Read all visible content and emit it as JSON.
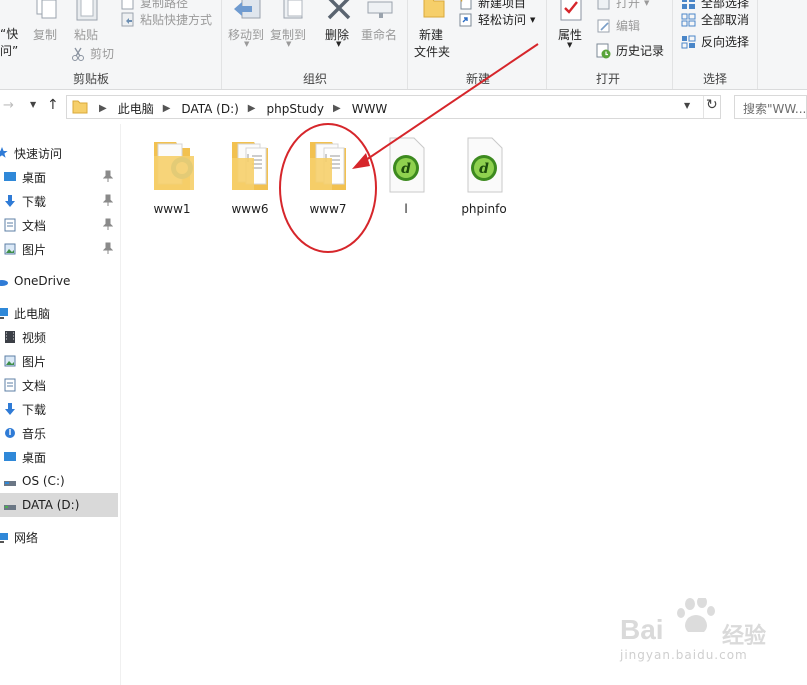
{
  "ribbon": {
    "clipboard": {
      "pin_label_line1": "“快",
      "pin_label_line2": "问”",
      "copy_label": "复制",
      "paste_label": "粘贴",
      "copy_path_label": "复制路径",
      "paste_shortcut_label": "粘贴快捷方式",
      "cut_label": "剪切",
      "group_label": "剪贴板"
    },
    "organize": {
      "move_to_label": "移动到",
      "copy_to_label": "复制到",
      "delete_label": "删除",
      "rename_label": "重命名",
      "group_label": "组织"
    },
    "new": {
      "new_folder_line1": "新建",
      "new_folder_line2": "文件夹",
      "new_item_label": "新建项目",
      "easy_access_label": "轻松访问",
      "group_label": "新建"
    },
    "open": {
      "properties_label": "属性",
      "open_label": "打开",
      "edit_label": "编辑",
      "history_label": "历史记录",
      "group_label": "打开"
    },
    "select": {
      "select_all_label": "全部选择",
      "select_none_label": "全部取消",
      "invert_label": "反向选择",
      "group_label": "选择"
    }
  },
  "address": {
    "crumbs": [
      "此电脑",
      "DATA (D:)",
      "phpStudy",
      "WWW"
    ],
    "search_placeholder": "搜索\"WW..."
  },
  "sidebar": {
    "items": [
      {
        "label": "快速访问",
        "icon": "star-icon"
      },
      {
        "label": "桌面",
        "icon": "desktop-icon"
      },
      {
        "label": "下载",
        "icon": "download-icon"
      },
      {
        "label": "文档",
        "icon": "document-icon"
      },
      {
        "label": "图片",
        "icon": "picture-icon"
      },
      {
        "label": "OneDrive",
        "icon": "cloud-icon"
      },
      {
        "label": "此电脑",
        "icon": "computer-icon"
      },
      {
        "label": "视频",
        "icon": "video-icon"
      },
      {
        "label": "图片",
        "icon": "picture-icon"
      },
      {
        "label": "文档",
        "icon": "document-icon"
      },
      {
        "label": "下载",
        "icon": "download-icon"
      },
      {
        "label": "音乐",
        "icon": "music-icon"
      },
      {
        "label": "桌面",
        "icon": "desktop-icon"
      },
      {
        "label": "OS (C:)",
        "icon": "drive-icon"
      },
      {
        "label": "DATA (D:)",
        "icon": "drive-icon"
      },
      {
        "label": "网络",
        "icon": "network-icon"
      }
    ]
  },
  "files": [
    {
      "name": "www1",
      "type": "folder"
    },
    {
      "name": "www6",
      "type": "folder"
    },
    {
      "name": "www7",
      "type": "folder"
    },
    {
      "name": "l",
      "type": "dreamweaver-file"
    },
    {
      "name": "phpinfo",
      "type": "dreamweaver-file"
    }
  ],
  "watermark": {
    "brand": "Bai",
    "brand_tail": "经验",
    "url": "jingyan.baidu.com"
  },
  "colors": {
    "annotation_red": "#d6262b",
    "folder_yellow": "#f6cf6a",
    "selected_bg": "#d9d9d9",
    "dw_green": "#3d8a1f"
  }
}
